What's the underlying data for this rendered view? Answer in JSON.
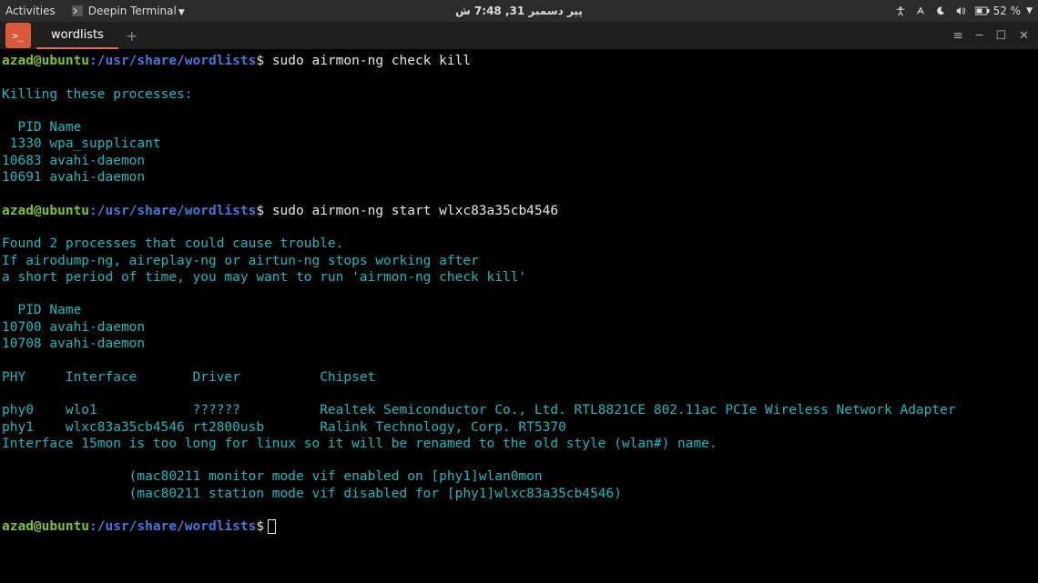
{
  "topbar": {
    "activities": "Activities",
    "app_name": "Deepin Terminal",
    "clock": "پیر دسمبر 31, 7:48 ش",
    "battery": "52 %"
  },
  "tabs": {
    "active": "wordlists"
  },
  "terminal": {
    "prompt_user": "azad@ubuntu",
    "prompt_path": ":/usr/share/wordlists",
    "prompt_sym": "$",
    "cmd1": "sudo airmon-ng check kill",
    "out1_l1": "",
    "out1_l2": "Killing these processes:",
    "out1_l3": "",
    "out1_l4": "  PID Name",
    "out1_l5": " 1330 wpa_supplicant",
    "out1_l6": "10683 avahi-daemon",
    "out1_l7": "10691 avahi-daemon",
    "out1_l8": "",
    "cmd2": "sudo airmon-ng start wlxc83a35cb4546",
    "out2_l1": "",
    "out2_l2": "Found 2 processes that could cause trouble.",
    "out2_l3": "If airodump-ng, aireplay-ng or airtun-ng stops working after",
    "out2_l4": "a short period of time, you may want to run 'airmon-ng check kill'",
    "out2_l5": "",
    "out2_l6": "  PID Name",
    "out2_l7": "10700 avahi-daemon",
    "out2_l8": "10708 avahi-daemon",
    "out2_l9": "",
    "out2_l10": "PHY     Interface       Driver          Chipset",
    "out2_l11": "",
    "out2_l12": "phy0    wlo1            ??????          Realtek Semiconductor Co., Ltd. RTL8821CE 802.11ac PCIe Wireless Network Adapter",
    "out2_l13": "phy1    wlxc83a35cb4546 rt2800usb       Ralink Technology, Corp. RT5370",
    "out2_l14": "Interface 15mon is too long for linux so it will be renamed to the old style (wlan#) name.",
    "out2_l15": "",
    "out2_l16": "                (mac80211 monitor mode vif enabled on [phy1]wlan0mon",
    "out2_l17": "                (mac80211 station mode vif disabled for [phy1]wlxc83a35cb4546)",
    "out2_l18": ""
  }
}
